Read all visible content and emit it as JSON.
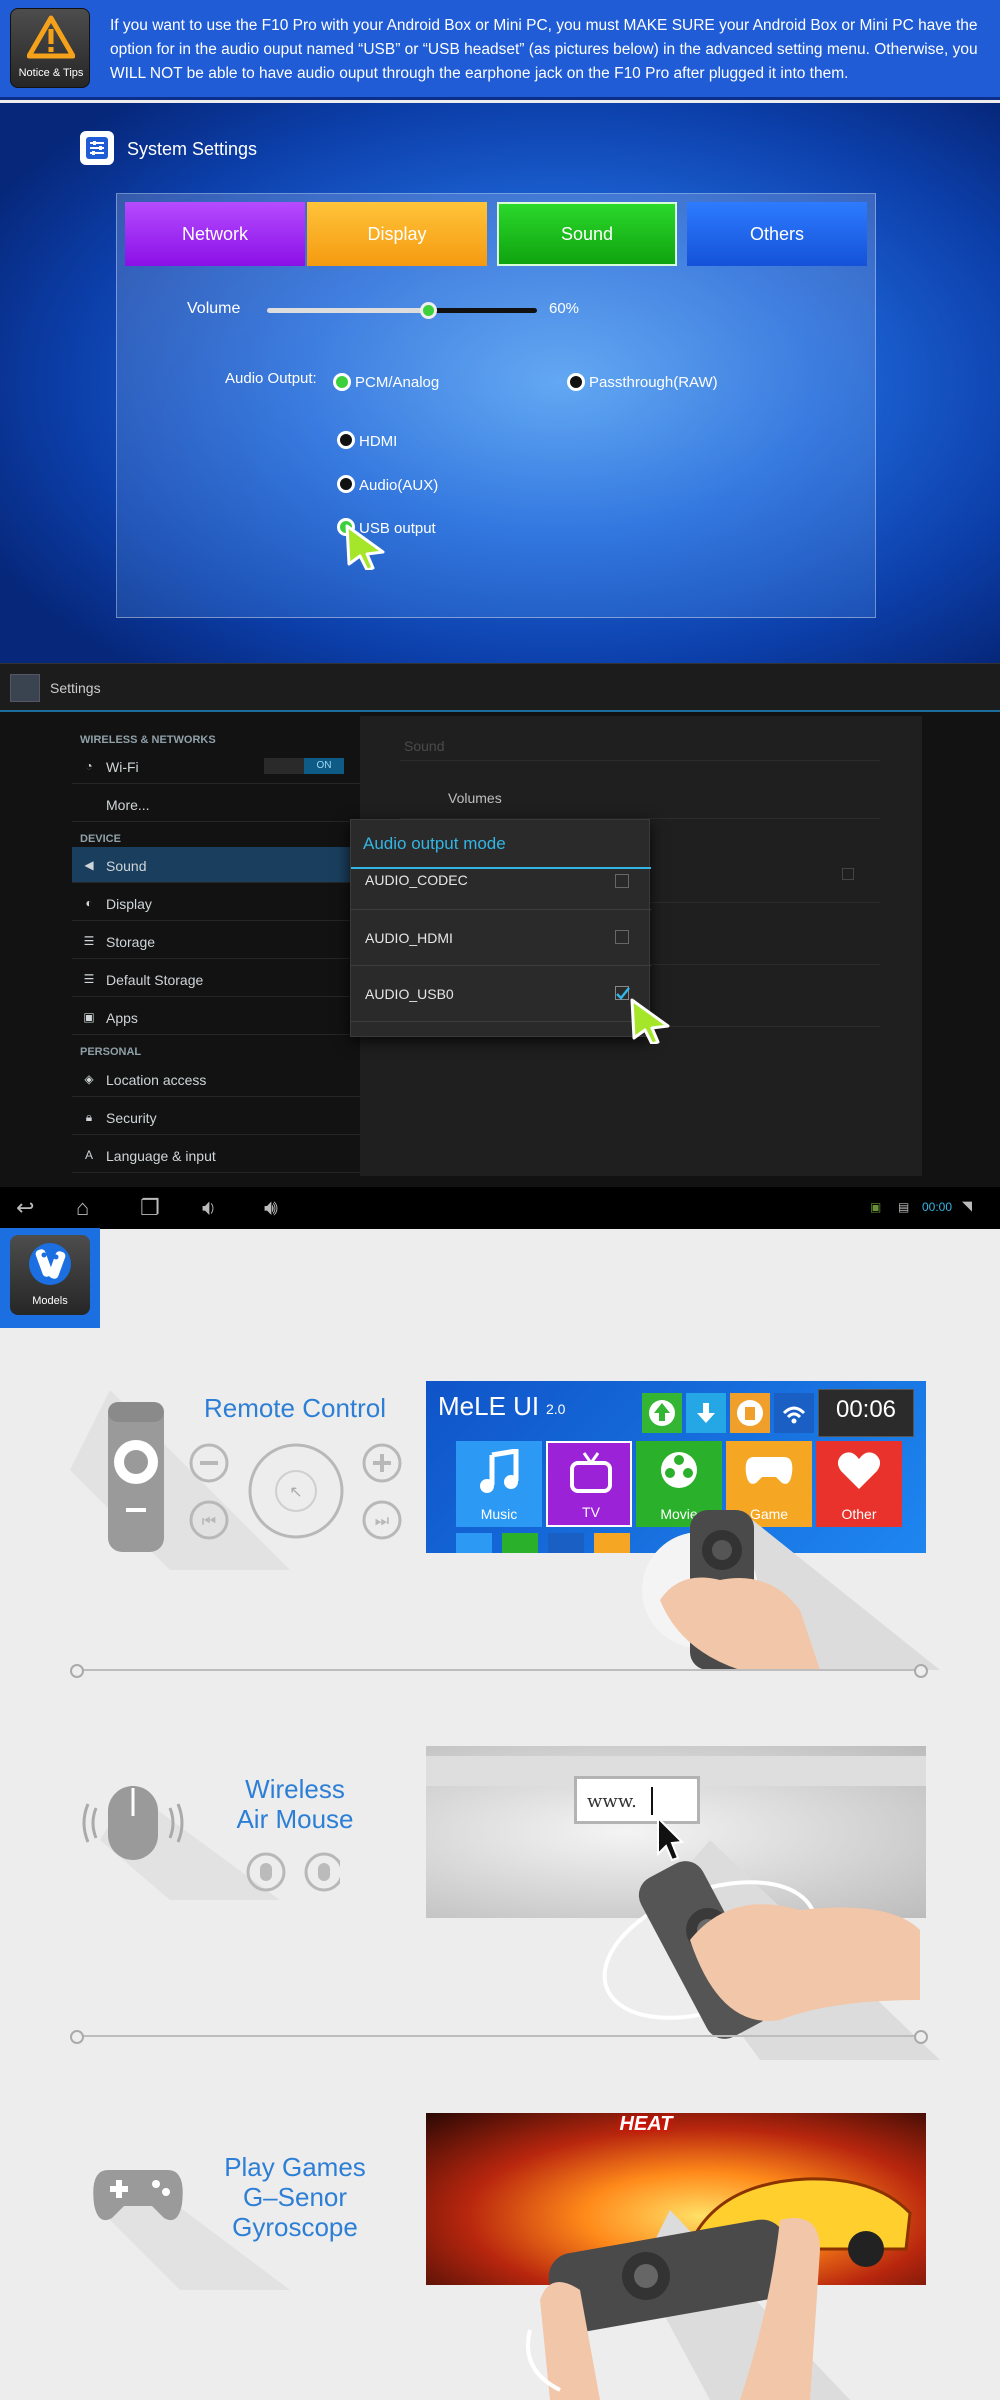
{
  "notice": {
    "badge_label": "Notice & Tips",
    "text": "If you want to use the F10 Pro with your Android Box or Mini PC, you must MAKE SURE your Android Box or Mini PC have the option for in the audio ouput named “USB” or “USB headset” (as pictures below) in the advanced setting menu. Otherwise, you WILL NOT be able to have audio ouput through the earphone jack on the F10 Pro after plugged it into them."
  },
  "system_settings": {
    "title": "System Settings",
    "tabs": [
      "Network",
      "Display",
      "Sound",
      "Others"
    ],
    "active_tab": "Sound",
    "volume_label": "Volume",
    "volume_value": "60%",
    "volume_level": 0.6,
    "audio_output_label": "Audio Output:",
    "options": [
      "PCM/Analog",
      "Passthrough(RAW)",
      "HDMI",
      "Audio(AUX)",
      "USB output"
    ],
    "selected": [
      "PCM/Analog",
      "USB output"
    ]
  },
  "android_settings": {
    "title": "Settings",
    "sections": {
      "wireless": "WIRELESS & NETWORKS",
      "device": "DEVICE",
      "personal": "PERSONAL"
    },
    "wifi": {
      "label": "Wi-Fi",
      "toggle": "ON"
    },
    "items": [
      "More...",
      "Sound",
      "Display",
      "Storage",
      "Default Storage",
      "Apps",
      "Location access",
      "Security",
      "Language & input"
    ],
    "selected_item": "Sound",
    "detail": {
      "header": "Sound",
      "row": "Volumes"
    },
    "dialog": {
      "title": "Audio output mode",
      "options": [
        "AUDIO_CODEC",
        "AUDIO_HDMI",
        "AUDIO_USB0"
      ],
      "checked": "AUDIO_USB0"
    },
    "status_time": "00:00"
  },
  "models": {
    "badge_label": "Models"
  },
  "features": {
    "remote": {
      "title": "Remote Control"
    },
    "airmouse": {
      "title_line1": "Wireless",
      "title_line2": "Air Mouse"
    },
    "games": {
      "title_line1": "Play Games",
      "title_line2": "G–Senor",
      "title_line3": "Gyroscope"
    }
  },
  "mele_ui": {
    "brand": "MeLE UI",
    "version": "2.0",
    "clock": "00:06",
    "tiles": [
      "Music",
      "TV",
      "Movie",
      "Game",
      "Other"
    ]
  },
  "browser": {
    "url_text": "www."
  },
  "game": {
    "banner": "HEAT"
  }
}
